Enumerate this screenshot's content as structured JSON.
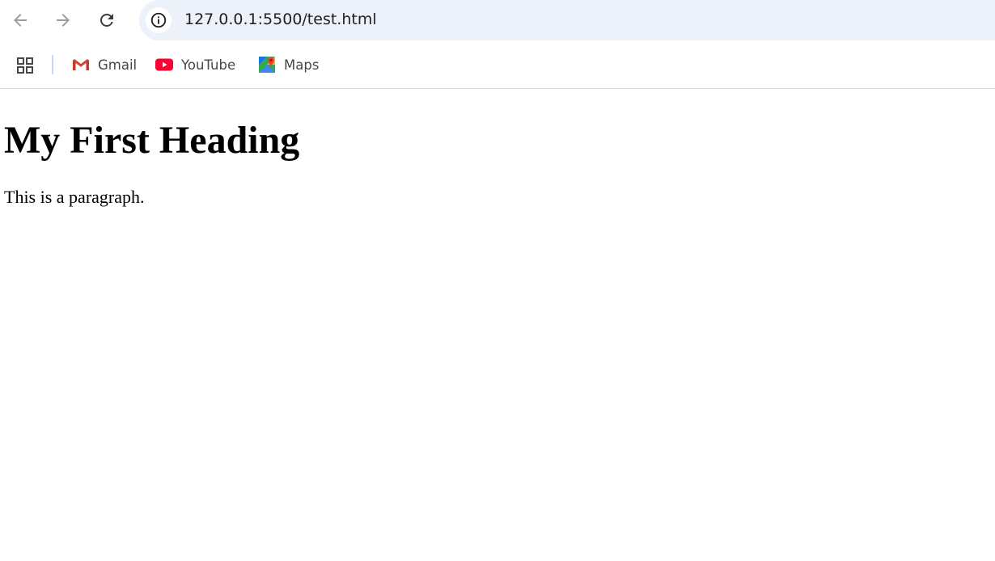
{
  "browser": {
    "nav": {
      "back_icon": "arrow-left-icon",
      "forward_icon": "arrow-right-icon",
      "reload_icon": "reload-icon"
    },
    "address_bar": {
      "url": "127.0.0.1:5500/test.html",
      "site_info_icon": "info-icon",
      "background": "#edf2fa"
    },
    "bookmarks": [
      {
        "label": "Gmail",
        "icon": "gmail-icon"
      },
      {
        "label": "YouTube",
        "icon": "youtube-icon"
      },
      {
        "label": "Maps",
        "icon": "maps-icon"
      }
    ],
    "apps_icon": "apps-grid-icon"
  },
  "page": {
    "heading": "My First Heading",
    "paragraph": "This is a paragraph."
  },
  "colors": {
    "youtube_red": "#ff0033",
    "text_dark": "#1f1f1f",
    "bookmark_text": "#474747"
  }
}
